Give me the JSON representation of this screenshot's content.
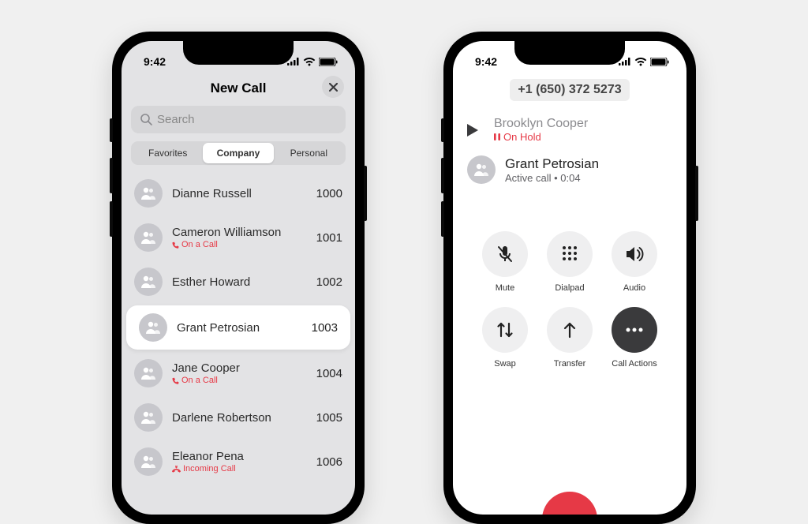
{
  "status": {
    "time": "9:42"
  },
  "left": {
    "title": "New Call",
    "search": {
      "placeholder": "Search"
    },
    "tabs": [
      "Favorites",
      "Company",
      "Personal"
    ],
    "active_tab": 1,
    "contacts": [
      {
        "name": "Dianne Russell",
        "ext": "1000",
        "sub": ""
      },
      {
        "name": "Cameron Williamson",
        "ext": "1001",
        "sub": "On a Call",
        "subicon": "phone"
      },
      {
        "name": "Esther Howard",
        "ext": "1002",
        "sub": ""
      },
      {
        "name": "Grant Petrosian",
        "ext": "1003",
        "sub": "",
        "selected": true
      },
      {
        "name": "Jane Cooper",
        "ext": "1004",
        "sub": "On a Call",
        "subicon": "phone"
      },
      {
        "name": "Darlene Robertson",
        "ext": "1005",
        "sub": ""
      },
      {
        "name": "Eleanor Pena",
        "ext": "1006",
        "sub": "Incoming Call",
        "subicon": "incoming"
      }
    ]
  },
  "right": {
    "number": "+1 (650) 372 5273",
    "hold": {
      "name": "Brooklyn Cooper",
      "status": "On Hold"
    },
    "active": {
      "name": "Grant Petrosian",
      "status": "Active call • 0:04"
    },
    "buttons": [
      {
        "label": "Mute",
        "icon": "mute"
      },
      {
        "label": "Dialpad",
        "icon": "dialpad"
      },
      {
        "label": "Audio",
        "icon": "audio"
      },
      {
        "label": "Swap",
        "icon": "swap"
      },
      {
        "label": "Transfer",
        "icon": "transfer"
      },
      {
        "label": "Call Actions",
        "icon": "more",
        "dark": true
      }
    ]
  }
}
